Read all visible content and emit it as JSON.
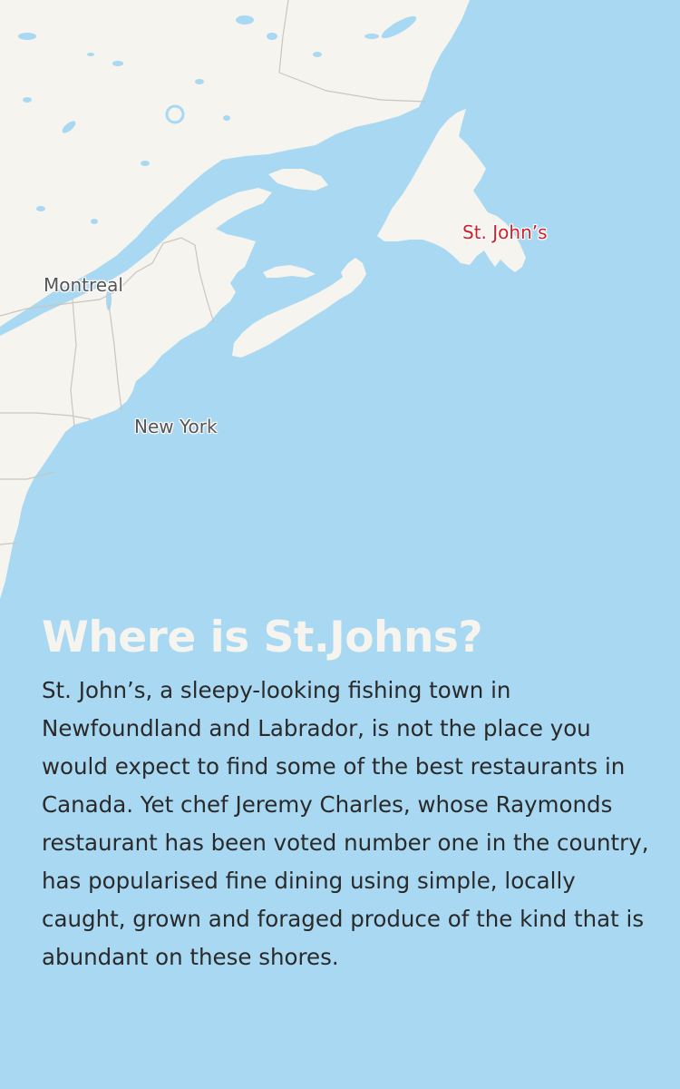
{
  "map": {
    "colors": {
      "land": "#f6f4ee",
      "water": "#a9d8f2",
      "border": "#c9c6bf",
      "highlight": "#d0202a"
    },
    "labels": {
      "montreal": "Montreal",
      "new_york": "New York",
      "st_johns": "St. John’s"
    }
  },
  "article": {
    "title": "Where is St.Johns?",
    "body": "St. John’s, a sleepy-looking fishing town in Newfoundland and Labrador, is not the place you would expect to find some of the best restaurants in Canada. Yet chef Jeremy Charles, whose Raymonds restaurant has been voted number one in the country, has popularised fine dining using simple, locally caught, grown and foraged produce of the kind that is abundant on these shores."
  }
}
